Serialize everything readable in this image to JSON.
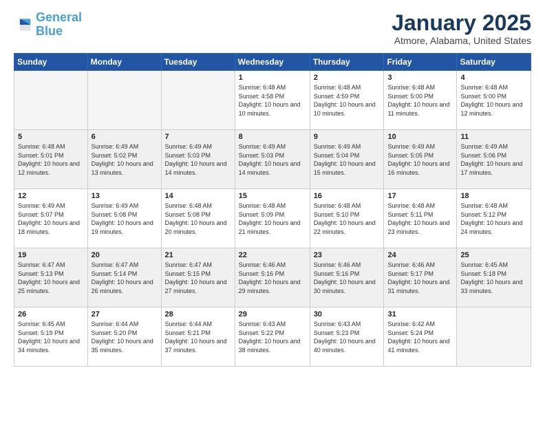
{
  "header": {
    "logo_line1": "General",
    "logo_line2": "Blue",
    "title": "January 2025",
    "subtitle": "Atmore, Alabama, United States"
  },
  "days_of_week": [
    "Sunday",
    "Monday",
    "Tuesday",
    "Wednesday",
    "Thursday",
    "Friday",
    "Saturday"
  ],
  "weeks": [
    [
      {
        "num": "",
        "empty": true
      },
      {
        "num": "",
        "empty": true
      },
      {
        "num": "",
        "empty": true
      },
      {
        "num": "1",
        "sunrise": "6:48 AM",
        "sunset": "4:58 PM",
        "daylight": "10 hours and 10 minutes."
      },
      {
        "num": "2",
        "sunrise": "6:48 AM",
        "sunset": "4:59 PM",
        "daylight": "10 hours and 10 minutes."
      },
      {
        "num": "3",
        "sunrise": "6:48 AM",
        "sunset": "5:00 PM",
        "daylight": "10 hours and 11 minutes."
      },
      {
        "num": "4",
        "sunrise": "6:48 AM",
        "sunset": "5:00 PM",
        "daylight": "10 hours and 12 minutes."
      }
    ],
    [
      {
        "num": "5",
        "sunrise": "6:48 AM",
        "sunset": "5:01 PM",
        "daylight": "10 hours and 12 minutes."
      },
      {
        "num": "6",
        "sunrise": "6:49 AM",
        "sunset": "5:02 PM",
        "daylight": "10 hours and 13 minutes."
      },
      {
        "num": "7",
        "sunrise": "6:49 AM",
        "sunset": "5:03 PM",
        "daylight": "10 hours and 14 minutes."
      },
      {
        "num": "8",
        "sunrise": "6:49 AM",
        "sunset": "5:03 PM",
        "daylight": "10 hours and 14 minutes."
      },
      {
        "num": "9",
        "sunrise": "6:49 AM",
        "sunset": "5:04 PM",
        "daylight": "10 hours and 15 minutes."
      },
      {
        "num": "10",
        "sunrise": "6:49 AM",
        "sunset": "5:05 PM",
        "daylight": "10 hours and 16 minutes."
      },
      {
        "num": "11",
        "sunrise": "6:49 AM",
        "sunset": "5:06 PM",
        "daylight": "10 hours and 17 minutes."
      }
    ],
    [
      {
        "num": "12",
        "sunrise": "6:49 AM",
        "sunset": "5:07 PM",
        "daylight": "10 hours and 18 minutes."
      },
      {
        "num": "13",
        "sunrise": "6:49 AM",
        "sunset": "5:08 PM",
        "daylight": "10 hours and 19 minutes."
      },
      {
        "num": "14",
        "sunrise": "6:48 AM",
        "sunset": "5:08 PM",
        "daylight": "10 hours and 20 minutes."
      },
      {
        "num": "15",
        "sunrise": "6:48 AM",
        "sunset": "5:09 PM",
        "daylight": "10 hours and 21 minutes."
      },
      {
        "num": "16",
        "sunrise": "6:48 AM",
        "sunset": "5:10 PM",
        "daylight": "10 hours and 22 minutes."
      },
      {
        "num": "17",
        "sunrise": "6:48 AM",
        "sunset": "5:11 PM",
        "daylight": "10 hours and 23 minutes."
      },
      {
        "num": "18",
        "sunrise": "6:48 AM",
        "sunset": "5:12 PM",
        "daylight": "10 hours and 24 minutes."
      }
    ],
    [
      {
        "num": "19",
        "sunrise": "6:47 AM",
        "sunset": "5:13 PM",
        "daylight": "10 hours and 25 minutes."
      },
      {
        "num": "20",
        "sunrise": "6:47 AM",
        "sunset": "5:14 PM",
        "daylight": "10 hours and 26 minutes."
      },
      {
        "num": "21",
        "sunrise": "6:47 AM",
        "sunset": "5:15 PM",
        "daylight": "10 hours and 27 minutes."
      },
      {
        "num": "22",
        "sunrise": "6:46 AM",
        "sunset": "5:16 PM",
        "daylight": "10 hours and 29 minutes."
      },
      {
        "num": "23",
        "sunrise": "6:46 AM",
        "sunset": "5:16 PM",
        "daylight": "10 hours and 30 minutes."
      },
      {
        "num": "24",
        "sunrise": "6:46 AM",
        "sunset": "5:17 PM",
        "daylight": "10 hours and 31 minutes."
      },
      {
        "num": "25",
        "sunrise": "6:45 AM",
        "sunset": "5:18 PM",
        "daylight": "10 hours and 33 minutes."
      }
    ],
    [
      {
        "num": "26",
        "sunrise": "6:45 AM",
        "sunset": "5:19 PM",
        "daylight": "10 hours and 34 minutes."
      },
      {
        "num": "27",
        "sunrise": "6:44 AM",
        "sunset": "5:20 PM",
        "daylight": "10 hours and 35 minutes."
      },
      {
        "num": "28",
        "sunrise": "6:44 AM",
        "sunset": "5:21 PM",
        "daylight": "10 hours and 37 minutes."
      },
      {
        "num": "29",
        "sunrise": "6:43 AM",
        "sunset": "5:22 PM",
        "daylight": "10 hours and 38 minutes."
      },
      {
        "num": "30",
        "sunrise": "6:43 AM",
        "sunset": "5:23 PM",
        "daylight": "10 hours and 40 minutes."
      },
      {
        "num": "31",
        "sunrise": "6:42 AM",
        "sunset": "5:24 PM",
        "daylight": "10 hours and 41 minutes."
      },
      {
        "num": "",
        "empty": true
      }
    ]
  ]
}
